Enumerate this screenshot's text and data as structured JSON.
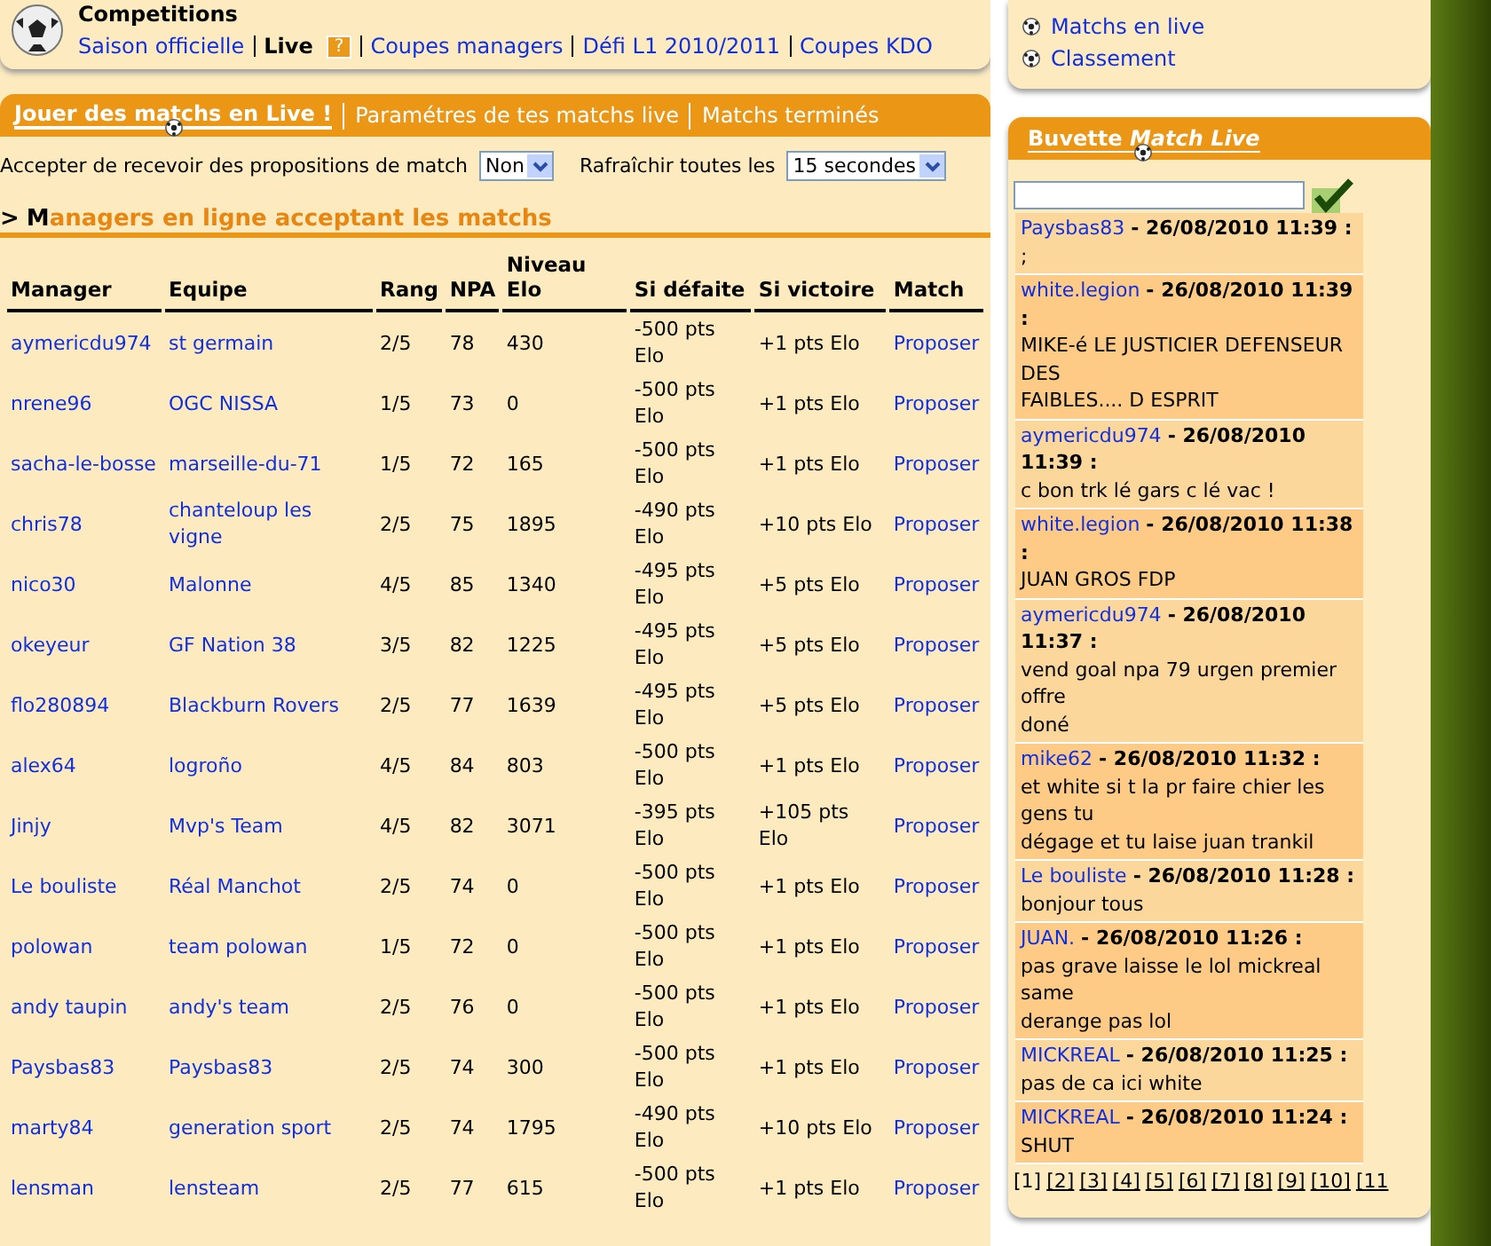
{
  "header": {
    "title": "Competitions",
    "links": [
      {
        "label": "Saison officielle",
        "selected": false
      },
      {
        "label": "Live",
        "selected": true,
        "help": "?"
      },
      {
        "label": "Coupes managers",
        "selected": false
      },
      {
        "label": "Défi L1 2010/2011",
        "selected": false
      },
      {
        "label": "Coupes KDO",
        "selected": false
      }
    ]
  },
  "tabs": [
    {
      "label": "Jouer des matchs en Live !",
      "selected": true
    },
    {
      "label": "Paramétres de tes matchs live",
      "selected": false
    },
    {
      "label": "Matchs terminés",
      "selected": false
    }
  ],
  "options": [
    {
      "label": "Accepter de recevoir des propositions de match",
      "value": "Non"
    },
    {
      "label": "Rafraîchir toutes les",
      "value": "15 secondes"
    }
  ],
  "section": {
    "marker": ">",
    "title": "Managers en ligne acceptant les matchs"
  },
  "table": {
    "columns": [
      "Manager",
      "Equipe",
      "Rang",
      "NPA",
      "Niveau Elo",
      "Si défaite",
      "Si victoire",
      "Match"
    ],
    "rows": [
      {
        "manager": "aymericdu974",
        "team": "st germain",
        "rank": "2/5",
        "npa": "78",
        "elo": "430",
        "loss": "-500 pts Elo",
        "win": "+1 pts Elo",
        "action": "Proposer"
      },
      {
        "manager": "nrene96",
        "team": "OGC NISSA",
        "rank": "1/5",
        "npa": "73",
        "elo": "0",
        "loss": "-500 pts Elo",
        "win": "+1 pts Elo",
        "action": "Proposer"
      },
      {
        "manager": "sacha-le-bosse",
        "team": "marseille-du-71",
        "rank": "1/5",
        "npa": "72",
        "elo": "165",
        "loss": "-500 pts Elo",
        "win": "+1 pts Elo",
        "action": "Proposer"
      },
      {
        "manager": "chris78",
        "team": "chanteloup les vigne",
        "rank": "2/5",
        "npa": "75",
        "elo": "1895",
        "loss": "-490 pts Elo",
        "win": "+10 pts Elo",
        "action": "Proposer"
      },
      {
        "manager": "nico30",
        "team": "Malonne",
        "rank": "4/5",
        "npa": "85",
        "elo": "1340",
        "loss": "-495 pts Elo",
        "win": "+5 pts Elo",
        "action": "Proposer"
      },
      {
        "manager": "okeyeur",
        "team": "GF Nation 38",
        "rank": "3/5",
        "npa": "82",
        "elo": "1225",
        "loss": "-495 pts Elo",
        "win": "+5 pts Elo",
        "action": "Proposer"
      },
      {
        "manager": "flo280894",
        "team": "Blackburn Rovers",
        "rank": "2/5",
        "npa": "77",
        "elo": "1639",
        "loss": "-495 pts Elo",
        "win": "+5 pts Elo",
        "action": "Proposer"
      },
      {
        "manager": "alex64",
        "team": "logroño",
        "rank": "4/5",
        "npa": "84",
        "elo": "803",
        "loss": "-500 pts Elo",
        "win": "+1 pts Elo",
        "action": "Proposer"
      },
      {
        "manager": "Jinjy",
        "team": "Mvp's Team",
        "rank": "4/5",
        "npa": "82",
        "elo": "3071",
        "loss": "-395 pts Elo",
        "win": "+105 pts Elo",
        "action": "Proposer"
      },
      {
        "manager": "Le bouliste",
        "team": "Réal Manchot",
        "rank": "2/5",
        "npa": "74",
        "elo": "0",
        "loss": "-500 pts Elo",
        "win": "+1 pts Elo",
        "action": "Proposer"
      },
      {
        "manager": "polowan",
        "team": "team polowan",
        "rank": "1/5",
        "npa": "72",
        "elo": "0",
        "loss": "-500 pts Elo",
        "win": "+1 pts Elo",
        "action": "Proposer"
      },
      {
        "manager": "andy taupin",
        "team": "andy's team",
        "rank": "2/5",
        "npa": "76",
        "elo": "0",
        "loss": "-500 pts Elo",
        "win": "+1 pts Elo",
        "action": "Proposer"
      },
      {
        "manager": "Paysbas83",
        "team": "Paysbas83",
        "rank": "2/5",
        "npa": "74",
        "elo": "300",
        "loss": "-500 pts Elo",
        "win": "+1 pts Elo",
        "action": "Proposer"
      },
      {
        "manager": "marty84",
        "team": "generation sport",
        "rank": "2/5",
        "npa": "74",
        "elo": "1795",
        "loss": "-490 pts Elo",
        "win": "+10 pts Elo",
        "action": "Proposer"
      },
      {
        "manager": "lensman",
        "team": "lensteam",
        "rank": "2/5",
        "npa": "77",
        "elo": "615",
        "loss": "-500 pts Elo",
        "win": "+1 pts Elo",
        "action": "Proposer"
      }
    ]
  },
  "side_links": [
    "Matchs en live",
    "Classement"
  ],
  "chat": {
    "title": "Buvette",
    "title_em": "Match Live",
    "messages": [
      {
        "author": "Paysbas83",
        "time": "- 26/08/2010 11:39 :",
        "lines": [
          ";"
        ]
      },
      {
        "author": "white.legion",
        "time": "- 26/08/2010 11:39 :",
        "lines": [
          "MIKE-é LE JUSTICIER DEFENSEUR DES",
          "FAIBLES.... D ESPRIT"
        ]
      },
      {
        "author": "aymericdu974",
        "time": "- 26/08/2010 11:39 :",
        "lines": [
          "c bon trk lé gars c lé vac !"
        ]
      },
      {
        "author": "white.legion",
        "time": "- 26/08/2010 11:38 :",
        "lines": [
          "JUAN GROS FDP"
        ]
      },
      {
        "author": "aymericdu974",
        "time": "- 26/08/2010 11:37 :",
        "lines": [
          "vend goal npa 79 urgen premier offre",
          "doné"
        ]
      },
      {
        "author": "mike62",
        "time": "- 26/08/2010 11:32 :",
        "lines": [
          "et white si t la pr faire chier les gens tu",
          "dégage et tu laise juan trankil"
        ]
      },
      {
        "author": "Le bouliste",
        "time": "- 26/08/2010 11:28 :",
        "lines": [
          "bonjour tous"
        ]
      },
      {
        "author": "JUAN.",
        "time": "- 26/08/2010 11:26 :",
        "lines": [
          "pas grave laisse le lol mickreal same",
          "derange pas lol"
        ]
      },
      {
        "author": "MICKREAL",
        "time": "- 26/08/2010 11:25 :",
        "lines": [
          "pas de ca ici white"
        ]
      },
      {
        "author": "MICKREAL",
        "time": "- 26/08/2010 11:24 :",
        "lines": [
          "SHUT"
        ]
      }
    ],
    "pages": [
      {
        "label": "[1]",
        "selected": true
      },
      {
        "label": "[2]",
        "selected": false
      },
      {
        "label": "[3]",
        "selected": false
      },
      {
        "label": "[4]",
        "selected": false
      },
      {
        "label": "[5]",
        "selected": false
      },
      {
        "label": "[6]",
        "selected": false
      },
      {
        "label": "[7]",
        "selected": false
      },
      {
        "label": "[8]",
        "selected": false
      },
      {
        "label": "[9]",
        "selected": false
      },
      {
        "label": "[10]",
        "selected": false
      },
      {
        "label": "[11",
        "selected": false
      }
    ]
  }
}
